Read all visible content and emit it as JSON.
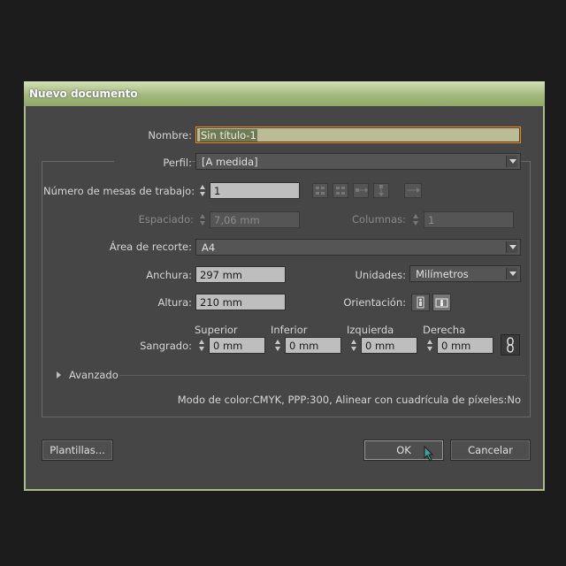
{
  "dialog": {
    "title": "Nuevo documento",
    "name_label": "Nombre:",
    "name_value": "Sin título-1",
    "profile_label": "Perfil:",
    "profile_value": "[A medida]",
    "artboards_label": "Número de mesas de trabajo:",
    "artboards_value": "1",
    "spacing_label": "Espaciado:",
    "spacing_value": "7,06 mm",
    "columns_label": "Columnas:",
    "columns_value": "1",
    "size_label": "Área de recorte:",
    "size_value": "A4",
    "width_label": "Anchura:",
    "width_value": "297 mm",
    "units_label": "Unidades:",
    "units_value": "Milímetros",
    "height_label": "Altura:",
    "height_value": "210 mm",
    "orientation_label": "Orientación:",
    "bleed_label": "Sangrado:",
    "bleed_top_label": "Superior",
    "bleed_top_value": "0 mm",
    "bleed_bottom_label": "Inferior",
    "bleed_bottom_value": "0 mm",
    "bleed_left_label": "Izquierda",
    "bleed_left_value": "0 mm",
    "bleed_right_label": "Derecha",
    "bleed_right_value": "0 mm",
    "advanced_label": "Avanzado",
    "info_text": "Modo de color:CMYK, PPP:300, Alinear con cuadrícula de píxeles:No",
    "templates_button": "Plantillas...",
    "ok_button": "OK",
    "cancel_button": "Cancelar"
  },
  "colors": {
    "titlebar": "#a2b87c",
    "dialog_bg": "#464646",
    "focus_border": "#e08a2c",
    "cursor": "#3aa39a"
  }
}
